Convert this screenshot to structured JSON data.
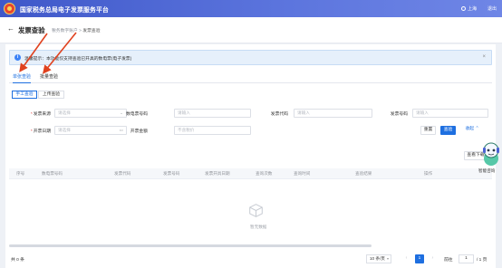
{
  "header": {
    "app_title": "国家税务总局电子发票服务平台",
    "user_text": "上海",
    "right_text": "退出"
  },
  "titlebar": {
    "back_icon": "back-arrow-icon",
    "page_title": "发票查验",
    "breadcrumb_parent": "税务数字账户",
    "breadcrumb_sep": ">",
    "breadcrumb_current": "发票查验"
  },
  "notice": {
    "text": "温馨提示：本功能仅支持查验已开具的数电票(电子发票)",
    "close": "×"
  },
  "main_tabs": [
    {
      "label": "单张查验",
      "active": true
    },
    {
      "label": "批量查验",
      "active": false
    }
  ],
  "sub_tabs": [
    {
      "label": "手工查验",
      "active": true
    },
    {
      "label": "上传查验",
      "active": false
    }
  ],
  "form": {
    "invoice_source": {
      "label": "发票来源",
      "placeholder": "请选择",
      "required": true
    },
    "digital_invoice_no": {
      "label": "数电票号码",
      "placeholder": "请输入"
    },
    "invoice_code": {
      "label": "发票代码",
      "placeholder": "请输入"
    },
    "invoice_no": {
      "label": "发票号码",
      "placeholder": "请输入"
    },
    "issue_date": {
      "label": "开票日期",
      "placeholder": "请选择",
      "required": true
    },
    "amount": {
      "label": "开票金额",
      "placeholder": "不含税价"
    }
  },
  "buttons": {
    "reset": "重置",
    "query": "查验",
    "collapse": "收起",
    "export": "查看下载"
  },
  "table": {
    "columns": [
      "序号",
      "数电票号码",
      "发票代码",
      "发票号码",
      "发票开具日期",
      "查询次数",
      "查询时间",
      "查验结果",
      "操作"
    ],
    "empty_text": "暂无数据"
  },
  "pagination": {
    "total": "共 0 条",
    "page_size": "10 条/页",
    "current_page": "1",
    "goto_label": "前往",
    "goto_value": "1",
    "total_pages": "/ 1 页"
  },
  "assistant": {
    "label": "智能咨询"
  },
  "colors": {
    "header": "#4a62d3",
    "primary": "#1e6fe0",
    "annotation_arrow": "#e0421f"
  }
}
